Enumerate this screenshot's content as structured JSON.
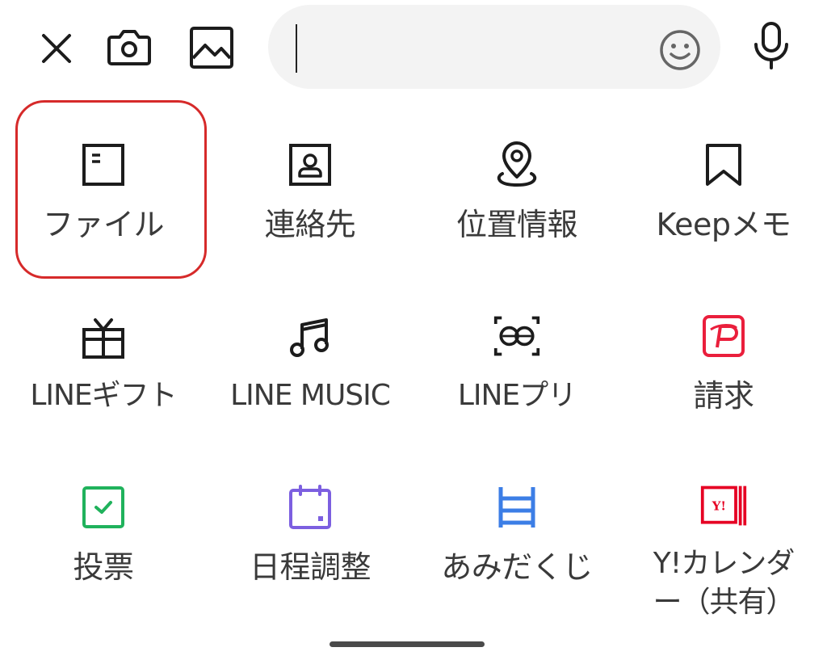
{
  "toolbar": {
    "close_icon": "close-icon",
    "camera_icon": "camera-icon",
    "image_icon": "image-icon",
    "emoji_icon": "emoji-icon",
    "mic_icon": "microphone-icon",
    "message_input": {
      "value": "",
      "placeholder": ""
    }
  },
  "menu": {
    "items": [
      {
        "label": "ファイル",
        "icon": "file-icon",
        "selected": true
      },
      {
        "label": "連絡先",
        "icon": "contact-icon"
      },
      {
        "label": "位置情報",
        "icon": "location-pin-icon"
      },
      {
        "label": "Keepメモ",
        "icon": "bookmark-icon"
      },
      {
        "label": "LINEギフト",
        "icon": "gift-icon"
      },
      {
        "label": "LINE MUSIC",
        "icon": "music-note-icon"
      },
      {
        "label": "LINEプリ",
        "icon": "photo-booth-icon"
      },
      {
        "label": "請求",
        "icon": "payment-request-icon",
        "color": "#ea1f3c"
      },
      {
        "label": "投票",
        "icon": "vote-icon",
        "color": "#20b25c"
      },
      {
        "label": "日程調整",
        "icon": "schedule-icon",
        "color": "#7c5fe0"
      },
      {
        "label": "あみだくじ",
        "icon": "ladder-lottery-icon",
        "color": "#3c7ee6"
      },
      {
        "label": "Y!カレンダー（共有）",
        "label_display": "Y!カレンダ\nー（共有）",
        "icon": "yahoo-calendar-icon",
        "color": "#e60023"
      }
    ]
  },
  "colors": {
    "selection_ring": "#d62a2a",
    "icon_default": "#1c1c1c",
    "label_text": "#3a3a3a",
    "search_bg": "#f3f3f3"
  }
}
